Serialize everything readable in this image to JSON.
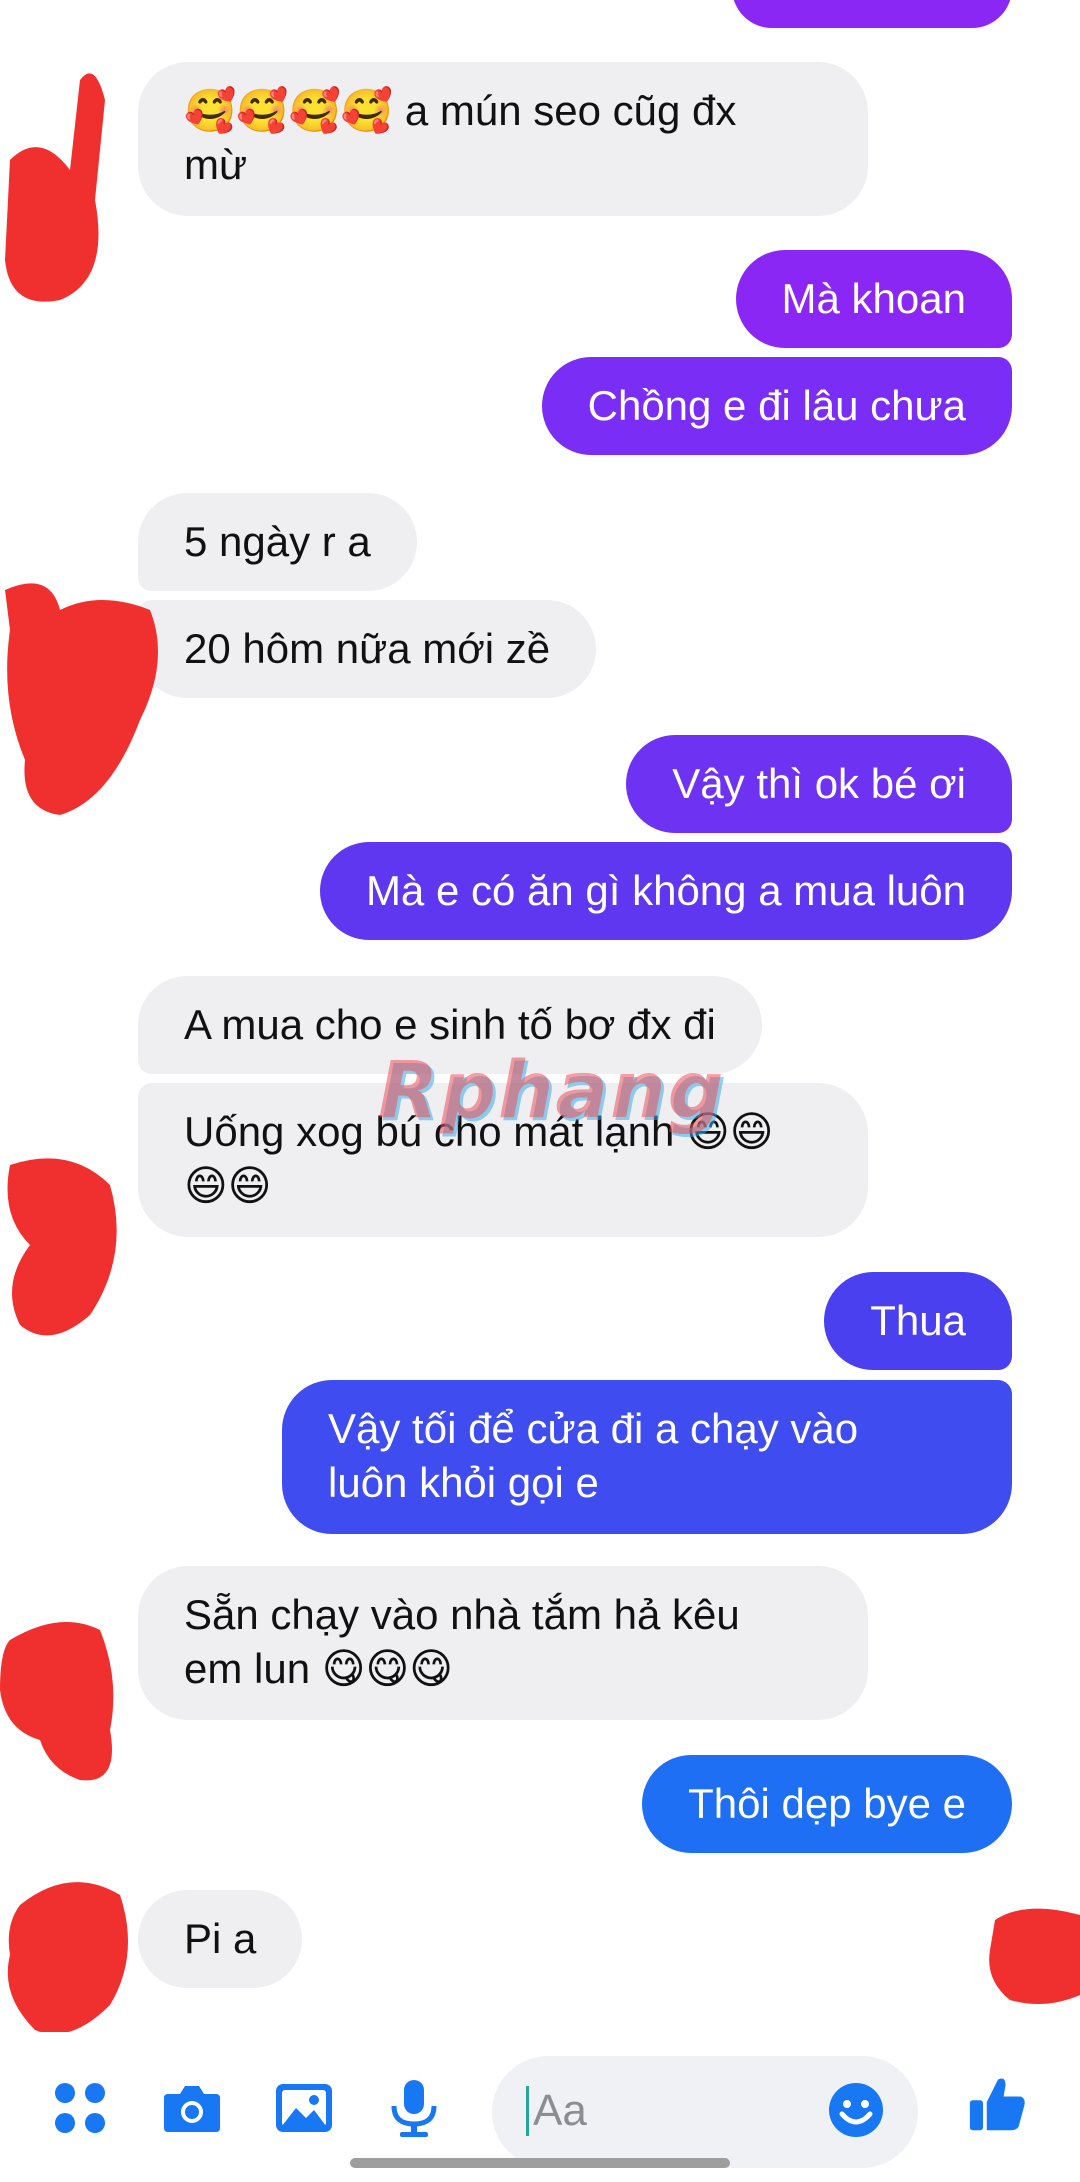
{
  "colors": {
    "incoming_bg": "#efeff1",
    "outgoing_purple": "#8b27f5",
    "outgoing_violet": "#6d32f2",
    "outgoing_indigo": "#4a40ef",
    "outgoing_blue": "#2f5ff2",
    "outgoing_lightblue": "#1f6ff4",
    "accent_blue": "#1877f2",
    "scribble_red": "#f0302e"
  },
  "messages": [
    {
      "direction": "incoming",
      "text": "🥰🥰🥰🥰 a mún seo cũg đx\nmừ"
    },
    {
      "direction": "outgoing",
      "text": "Mà khoan"
    },
    {
      "direction": "outgoing",
      "text": "Chồng e đi lâu chưa"
    },
    {
      "direction": "incoming",
      "text": "5 ngày r a"
    },
    {
      "direction": "incoming",
      "text": "20 hôm nữa mới zề"
    },
    {
      "direction": "outgoing",
      "text": "Vậy thì ok bé ơi"
    },
    {
      "direction": "outgoing",
      "text": "Mà e có ăn gì không a mua luôn"
    },
    {
      "direction": "incoming",
      "text": "A mua cho e sinh tố bơ đx đi"
    },
    {
      "direction": "incoming",
      "text": "Uống xog bú cho mát lạnh 😄😄\n😄😄"
    },
    {
      "direction": "outgoing",
      "text": "Thua"
    },
    {
      "direction": "outgoing",
      "text": "Vậy tối để cửa đi a chạy vào\nluôn khỏi gọi e"
    },
    {
      "direction": "incoming",
      "text": "Sẵn chạy vào nhà tắm hả kêu\nem lun 😋😋😋"
    },
    {
      "direction": "outgoing",
      "text": "Thôi dẹp bye e"
    },
    {
      "direction": "incoming",
      "text": "Pi a"
    }
  ],
  "watermark": "Rphang",
  "composer": {
    "placeholder": "Aa",
    "icons": [
      "apps-icon",
      "camera-icon",
      "image-icon",
      "microphone-icon",
      "emoji-icon",
      "thumbs-up-icon"
    ]
  }
}
